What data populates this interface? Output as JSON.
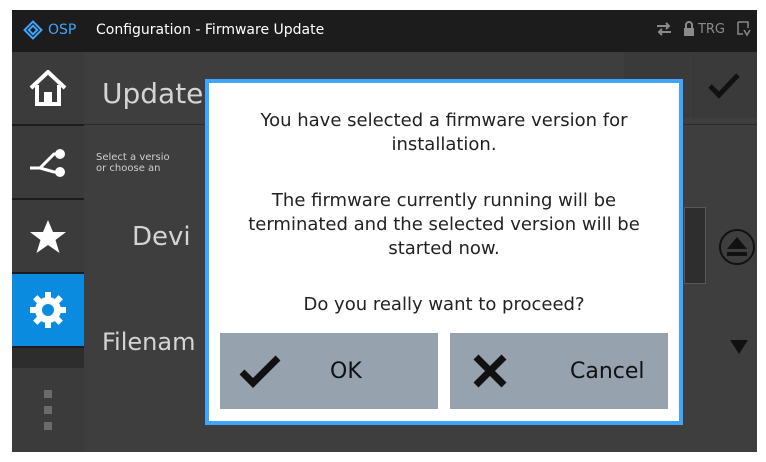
{
  "titlebar": {
    "brand": "OSP",
    "title": "Configuration - Firmware Update",
    "trg_label": "TRG",
    "icons": [
      "osp-logo-icon",
      "swap-arrows-icon",
      "lock-icon",
      "screen-down-icon"
    ]
  },
  "nav": {
    "items": [
      {
        "icon": "home-icon"
      },
      {
        "icon": "network-path-icon"
      },
      {
        "icon": "star-icon"
      },
      {
        "icon": "gear-icon",
        "active": true
      },
      {
        "icon": "more-dots-icon"
      }
    ]
  },
  "background": {
    "page_title": "Update",
    "description_line1": "Select a versio",
    "description_line2": "or choose an",
    "device_label": "Devi",
    "filename_label": "Filenam"
  },
  "dialog": {
    "line1": "You have selected a firmware version for",
    "line2": "installation.",
    "line3": "The firmware currently running will be",
    "line4": "terminated and the selected version will be",
    "line5": "started now.",
    "line6": "Do you really want to proceed?",
    "ok_label": "OK",
    "cancel_label": "Cancel"
  },
  "colors": {
    "accent": "#3ea6ff",
    "nav_active": "#0b8be0",
    "dialog_button": "#96a2ad"
  }
}
